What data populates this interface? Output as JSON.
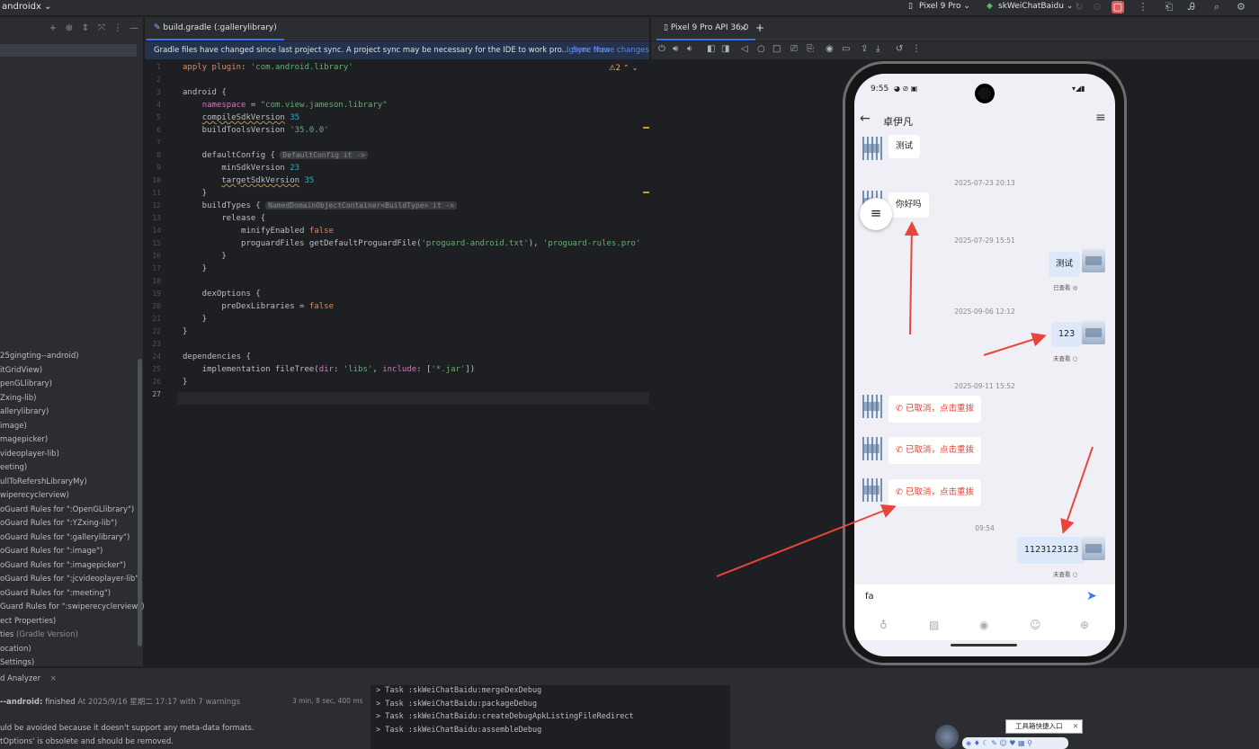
{
  "topbar": {
    "project": "androidx ⌄",
    "device": "Pixel 9 Pro ⌄",
    "config": "skWeiChatBaidu ⌄",
    "colors": {
      "stop": "#db5c5c"
    }
  },
  "left_tree": [
    {
      "label": "25gingting--android)",
      "gray": ""
    },
    {
      "label": "itGridView)",
      "gray": ""
    },
    {
      "label": "penGLlibrary)",
      "gray": ""
    },
    {
      "label": "Zxing-lib)",
      "gray": ""
    },
    {
      "label": "allerylibrary)",
      "gray": ""
    },
    {
      "label": "image)",
      "gray": ""
    },
    {
      "label": "magepicker)",
      "gray": ""
    },
    {
      "label": "videoplayer-lib)",
      "gray": ""
    },
    {
      "label": "eeting)",
      "gray": ""
    },
    {
      "label": "ullToRefershLibraryMy)",
      "gray": ""
    },
    {
      "label": "wiperecyclerview)",
      "gray": ""
    },
    {
      "label": "oGuard Rules for \":OpenGLlibrary\")",
      "gray": ""
    },
    {
      "label": "oGuard Rules for \":YZxing-lib\")",
      "gray": ""
    },
    {
      "label": "oGuard Rules for \":gallerylibrary\")",
      "gray": ""
    },
    {
      "label": "oGuard Rules for \":image\")",
      "gray": ""
    },
    {
      "label": "oGuard Rules for \":imagepicker\")",
      "gray": ""
    },
    {
      "label": "oGuard Rules for \":jcvideoplayer-lib\")",
      "gray": ""
    },
    {
      "label": "oGuard Rules for \":meeting\")",
      "gray": ""
    },
    {
      "label": "Guard Rules for \":swiperecyclerview\")",
      "gray": ""
    },
    {
      "label": "ect Properties)",
      "gray": ""
    },
    {
      "label": "ties",
      "gray": " (Gradle Version)"
    },
    {
      "label": "ocation)",
      "gray": ""
    },
    {
      "label": " Settings)",
      "gray": ""
    }
  ],
  "editor": {
    "tab": "build.gradle (:gallerylibrary)",
    "banner": "Gradle files have changed since last project sync. A project sync may be necessary for the IDE to work pro...",
    "sync_now": "Sync Now",
    "ignore": "Ignore these changes",
    "warnings": "⚠2 ⌃ ⌄",
    "line_numbers": [
      "1",
      "2",
      "3",
      "4",
      "5",
      "6",
      "7",
      "8",
      "9",
      "10",
      "11",
      "12",
      "13",
      "14",
      "15",
      "16",
      "17",
      "18",
      "19",
      "20",
      "21",
      "22",
      "23",
      "24",
      "25",
      "26",
      "27"
    ],
    "hint_default": "DefaultConfig it ->",
    "hint_build": "NamedDomainObjectContainer<BuildType> it ->"
  },
  "emulator": {
    "tab": "Pixel 9 Pro API 36.0",
    "tab_close": "×",
    "tab_add": "+"
  },
  "phone": {
    "status_time": "9:55",
    "status_right": "▾◢▮",
    "title": "卓伊凡",
    "menu": "≡",
    "messages": {
      "m1": "测试",
      "t1": "2025-07-23 20:13",
      "m2": "你好吗",
      "t2": "2025-07-29 15:51",
      "m3": "测试",
      "r3": "已查看 ◎",
      "t3": "2025-09-06 12:12",
      "m4": "123",
      "r4": "未查看 ○",
      "t4": "2025-09-11 15:52",
      "m5": "已取消，点击重拨",
      "m6": "已取消，点击重拨",
      "m7": "已取消，点击重拨",
      "t5": "09:54",
      "m8": "1123123123",
      "r8": "未查看 ○"
    },
    "input_value": "fa"
  },
  "build": {
    "panel_title": "d Analyzer",
    "panel_close": "×",
    "status_bold": "--android:",
    "status_finished": "finished",
    "status_rest": "At 2025/9/16 星期二 17:17 with 7 warnings",
    "duration": "3 min, 8 sec, 400 ms",
    "warn1": "uld be avoided because it doesn't support any meta-data formats.",
    "warn2": "tOptions' is obsolete and should be removed.",
    "tasks": [
      "> Task :skWeiChatBaidu:mergeDexDebug",
      "> Task :skWeiChatBaidu:packageDebug",
      "> Task :skWeiChatBaidu:createDebugApkListingFileRedirect",
      "> Task :skWeiChatBaidu:assembleDebug"
    ]
  },
  "overlay": {
    "tooltip": "工具箱快捷入口",
    "tooltip_close": "✕",
    "colors": {
      "arrow": "#e8463c"
    }
  }
}
